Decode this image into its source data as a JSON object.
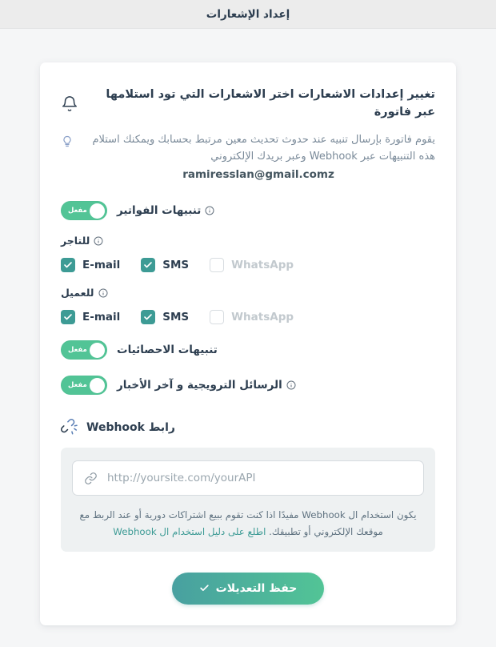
{
  "window": {
    "title": "إعداد الإشعارات"
  },
  "card": {
    "bell_icon": "bell-icon",
    "headline": "تغيير إعدادات الاشعارات اختر الاشعارات التي تود استلامها عبر فاتورة",
    "bulb_icon": "lightbulb-icon",
    "description": "يقوم فاتورة بإرسال تنبيه عند حدوث تحديث معين مرتبط بحسابك ويمكنك استلام هذه التنبيهات عبر Webhook وعبر بريدك الإلكتروني",
    "email": "ramiresslan@gmail.comz"
  },
  "toggles": {
    "invoices": {
      "label": "تنبيهات الفواتير",
      "has_info": true,
      "state_text": "مفعل",
      "enabled": true
    },
    "statistics": {
      "label": "تنبيهات الاحصائيات",
      "has_info": false,
      "state_text": "مفعل",
      "enabled": true
    },
    "promotions": {
      "label": "الرسائل الترويجية و آخر الأخبار",
      "has_info": true,
      "state_text": "مفعل",
      "enabled": true
    }
  },
  "groups": [
    {
      "title": "للتاجر",
      "has_info": true,
      "channels": [
        {
          "name": "E-mail",
          "checked": true,
          "dimmed": false
        },
        {
          "name": "SMS",
          "checked": true,
          "dimmed": false
        },
        {
          "name": "WhatsApp",
          "checked": false,
          "dimmed": true
        }
      ]
    },
    {
      "title": "للعميل",
      "has_info": true,
      "channels": [
        {
          "name": "E-mail",
          "checked": true,
          "dimmed": false
        },
        {
          "name": "SMS",
          "checked": true,
          "dimmed": false
        },
        {
          "name": "WhatsApp",
          "checked": false,
          "dimmed": true
        }
      ]
    }
  ],
  "webhook": {
    "icon": "unlink-icon",
    "title": "رابط Webhook",
    "input_icon": "link-icon",
    "url_value": "",
    "url_placeholder": "http://yoursite.com/yourAPI",
    "help_text": "يكون استخدام ال Webhook مفيدًا اذا كنت تقوم ببيع اشتراكات دورية أو عند الربط مع موقعك الإلكتروني أو تطبيقك.",
    "help_link": "اطلع على دليل استخدام ال Webhook"
  },
  "save": {
    "label": "حفظ التعديلات",
    "icon": "check-icon"
  },
  "colors": {
    "page_bg": "#f5f6f7",
    "topbar_bg": "#ececec",
    "card_bg": "#ffffff",
    "toggle_green": "#52c496",
    "checkbox_teal": "#3d9b95",
    "link_teal": "#3d9b95",
    "button_gradient_start": "#52c496",
    "button_gradient_end": "#48a0a0",
    "text_dark": "#2d3e50",
    "text_muted": "#7a8a99"
  }
}
